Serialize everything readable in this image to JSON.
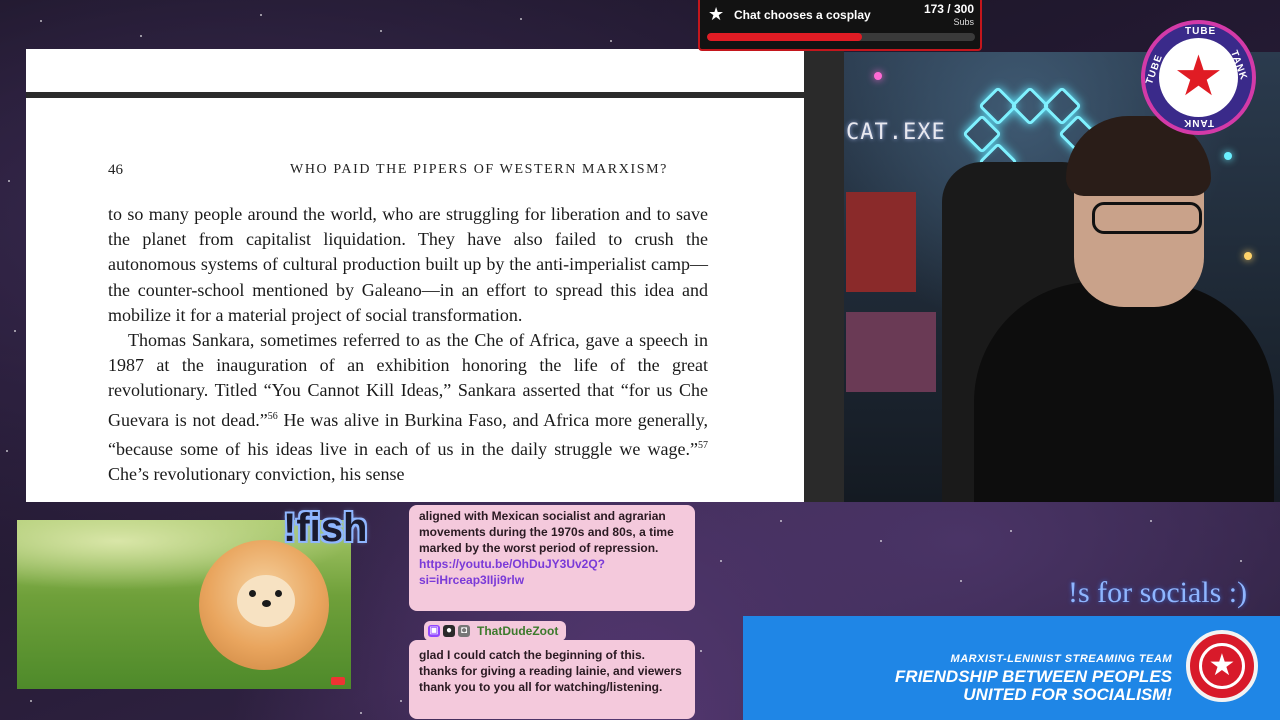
{
  "document": {
    "page_number": "46",
    "running_head": "WHO PAID THE PIPERS OF WESTERN MARXISM?",
    "paragraph_1": "to so many people around the world, who are struggling for liberation and to save the planet from capitalist liquidation. They have also failed to crush the autonomous systems of cultural production built up by the anti-imperialist camp—the counter-school mentioned by Galeano—in an effort to spread this idea and mobilize it for a material project of social transformation.",
    "paragraph_2_part_1": "Thomas Sankara, sometimes referred to as the Che of Africa, gave a speech in 1987 at the inauguration of an exhibition honoring the life of the great revolutionary. Titled “You Cannot Kill Ideas,” Sankara asserted that “for us Che Guevara is not dead.”",
    "footnote_56": "56",
    "paragraph_2_part_2": " He was alive in Burkina Faso, and Africa more generally, “because some of his ideas live in each of us in the daily struggle we wage.”",
    "footnote_57": "57",
    "paragraph_2_part_3": " Che’s revolutionary conviction, his sense"
  },
  "webcam": {
    "overlay_tag": "CAT.EXE"
  },
  "sub_goal": {
    "label": "Chat chooses a cosplay",
    "count": "173 / 300",
    "unit": "Subs",
    "progress": 0.577,
    "icon": "star-icon"
  },
  "channel_logo": {
    "text_top": "TUBE",
    "text_right": "TANK",
    "text_bottom": "TANK",
    "text_left": "TUBE",
    "icon": "red-star-icon"
  },
  "fish_command": "!fish",
  "chat": {
    "message_1": {
      "text": "aligned with Mexican socialist and agrarian movements during the 1970s and 80s, a time marked by the worst period of repression.",
      "link": "https://youtu.be/OhDuJY3Uv2Q?si=iHrceap3IIji9rlw"
    },
    "message_2": {
      "username": "ThatDudeZoot",
      "text": "glad I could catch the beginning of this. thanks for giving a reading lainie, and viewers thank you to you all for watching/listening."
    }
  },
  "socials_text": "!s for socials :)",
  "banner": {
    "subtitle": "MARXIST-LENINIST STREAMING TEAM",
    "title_line_1": "FRIENDSHIP BETWEEN PEOPLES",
    "title_line_2": "UNITED FOR SOCIALISM!"
  },
  "colors": {
    "goal_fill": "#e01c24",
    "chat_bubble": "#f4c9dc",
    "banner_blue": "#1f86e6",
    "username_green": "#3c7a2c",
    "link_purple": "#7a3ad8"
  }
}
